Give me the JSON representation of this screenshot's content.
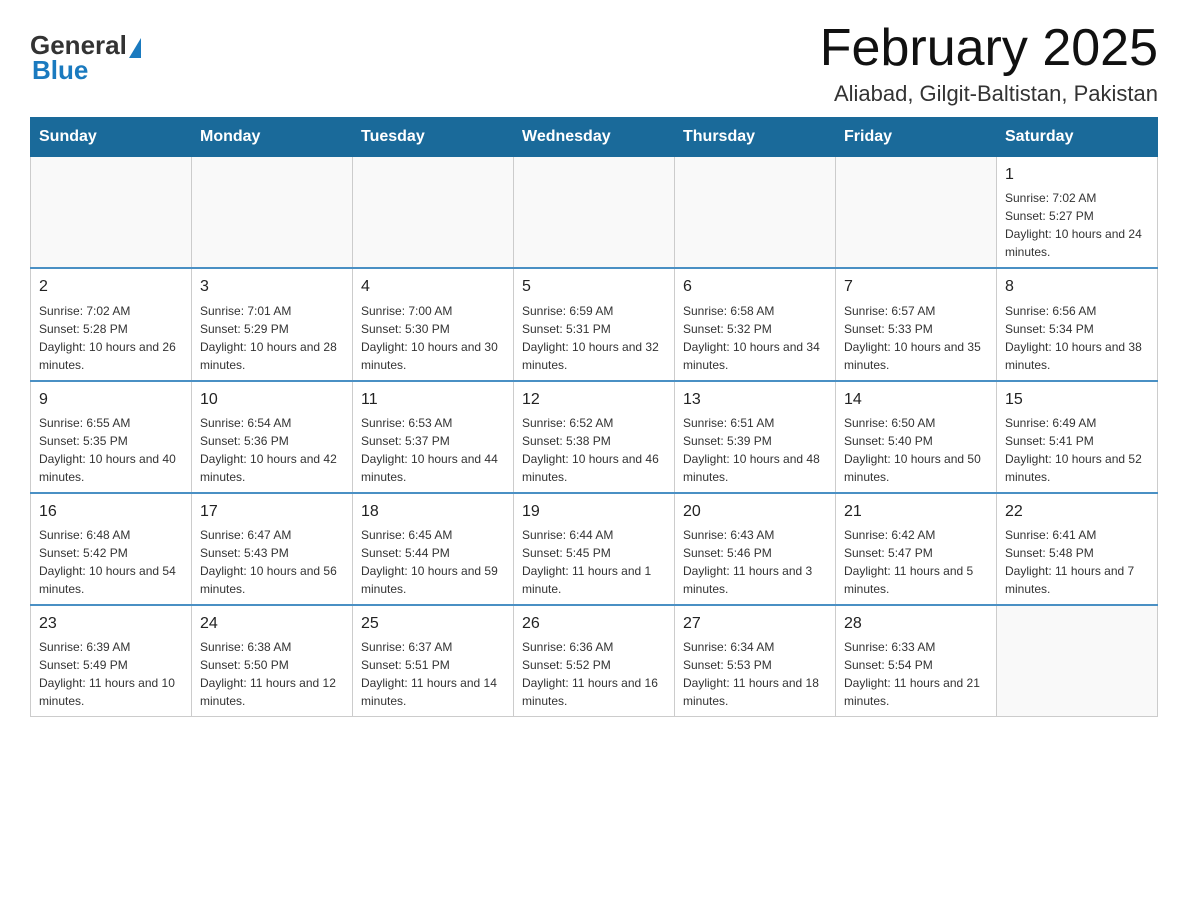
{
  "header": {
    "logo_general": "General",
    "logo_blue": "Blue",
    "month_title": "February 2025",
    "location": "Aliabad, Gilgit-Baltistan, Pakistan"
  },
  "days_of_week": [
    "Sunday",
    "Monday",
    "Tuesday",
    "Wednesday",
    "Thursday",
    "Friday",
    "Saturday"
  ],
  "weeks": [
    [
      {
        "date": "",
        "info": ""
      },
      {
        "date": "",
        "info": ""
      },
      {
        "date": "",
        "info": ""
      },
      {
        "date": "",
        "info": ""
      },
      {
        "date": "",
        "info": ""
      },
      {
        "date": "",
        "info": ""
      },
      {
        "date": "1",
        "info": "Sunrise: 7:02 AM\nSunset: 5:27 PM\nDaylight: 10 hours and 24 minutes."
      }
    ],
    [
      {
        "date": "2",
        "info": "Sunrise: 7:02 AM\nSunset: 5:28 PM\nDaylight: 10 hours and 26 minutes."
      },
      {
        "date": "3",
        "info": "Sunrise: 7:01 AM\nSunset: 5:29 PM\nDaylight: 10 hours and 28 minutes."
      },
      {
        "date": "4",
        "info": "Sunrise: 7:00 AM\nSunset: 5:30 PM\nDaylight: 10 hours and 30 minutes."
      },
      {
        "date": "5",
        "info": "Sunrise: 6:59 AM\nSunset: 5:31 PM\nDaylight: 10 hours and 32 minutes."
      },
      {
        "date": "6",
        "info": "Sunrise: 6:58 AM\nSunset: 5:32 PM\nDaylight: 10 hours and 34 minutes."
      },
      {
        "date": "7",
        "info": "Sunrise: 6:57 AM\nSunset: 5:33 PM\nDaylight: 10 hours and 35 minutes."
      },
      {
        "date": "8",
        "info": "Sunrise: 6:56 AM\nSunset: 5:34 PM\nDaylight: 10 hours and 38 minutes."
      }
    ],
    [
      {
        "date": "9",
        "info": "Sunrise: 6:55 AM\nSunset: 5:35 PM\nDaylight: 10 hours and 40 minutes."
      },
      {
        "date": "10",
        "info": "Sunrise: 6:54 AM\nSunset: 5:36 PM\nDaylight: 10 hours and 42 minutes."
      },
      {
        "date": "11",
        "info": "Sunrise: 6:53 AM\nSunset: 5:37 PM\nDaylight: 10 hours and 44 minutes."
      },
      {
        "date": "12",
        "info": "Sunrise: 6:52 AM\nSunset: 5:38 PM\nDaylight: 10 hours and 46 minutes."
      },
      {
        "date": "13",
        "info": "Sunrise: 6:51 AM\nSunset: 5:39 PM\nDaylight: 10 hours and 48 minutes."
      },
      {
        "date": "14",
        "info": "Sunrise: 6:50 AM\nSunset: 5:40 PM\nDaylight: 10 hours and 50 minutes."
      },
      {
        "date": "15",
        "info": "Sunrise: 6:49 AM\nSunset: 5:41 PM\nDaylight: 10 hours and 52 minutes."
      }
    ],
    [
      {
        "date": "16",
        "info": "Sunrise: 6:48 AM\nSunset: 5:42 PM\nDaylight: 10 hours and 54 minutes."
      },
      {
        "date": "17",
        "info": "Sunrise: 6:47 AM\nSunset: 5:43 PM\nDaylight: 10 hours and 56 minutes."
      },
      {
        "date": "18",
        "info": "Sunrise: 6:45 AM\nSunset: 5:44 PM\nDaylight: 10 hours and 59 minutes."
      },
      {
        "date": "19",
        "info": "Sunrise: 6:44 AM\nSunset: 5:45 PM\nDaylight: 11 hours and 1 minute."
      },
      {
        "date": "20",
        "info": "Sunrise: 6:43 AM\nSunset: 5:46 PM\nDaylight: 11 hours and 3 minutes."
      },
      {
        "date": "21",
        "info": "Sunrise: 6:42 AM\nSunset: 5:47 PM\nDaylight: 11 hours and 5 minutes."
      },
      {
        "date": "22",
        "info": "Sunrise: 6:41 AM\nSunset: 5:48 PM\nDaylight: 11 hours and 7 minutes."
      }
    ],
    [
      {
        "date": "23",
        "info": "Sunrise: 6:39 AM\nSunset: 5:49 PM\nDaylight: 11 hours and 10 minutes."
      },
      {
        "date": "24",
        "info": "Sunrise: 6:38 AM\nSunset: 5:50 PM\nDaylight: 11 hours and 12 minutes."
      },
      {
        "date": "25",
        "info": "Sunrise: 6:37 AM\nSunset: 5:51 PM\nDaylight: 11 hours and 14 minutes."
      },
      {
        "date": "26",
        "info": "Sunrise: 6:36 AM\nSunset: 5:52 PM\nDaylight: 11 hours and 16 minutes."
      },
      {
        "date": "27",
        "info": "Sunrise: 6:34 AM\nSunset: 5:53 PM\nDaylight: 11 hours and 18 minutes."
      },
      {
        "date": "28",
        "info": "Sunrise: 6:33 AM\nSunset: 5:54 PM\nDaylight: 11 hours and 21 minutes."
      },
      {
        "date": "",
        "info": ""
      }
    ]
  ]
}
